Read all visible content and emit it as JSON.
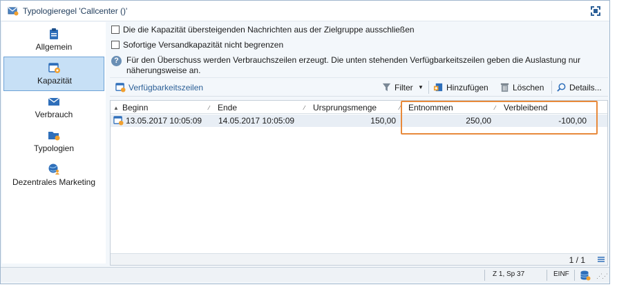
{
  "window": {
    "title": "Typologieregel 'Callcenter ()'"
  },
  "sidebar": {
    "items": [
      {
        "label": "Allgemein",
        "icon": "clipboard-icon"
      },
      {
        "label": "Kapazität",
        "icon": "calendar-gear-icon"
      },
      {
        "label": "Verbrauch",
        "icon": "envelope-down-icon"
      },
      {
        "label": "Typologien",
        "icon": "folder-rules-icon"
      },
      {
        "label": "Dezentrales Marketing",
        "icon": "globe-user-icon"
      }
    ],
    "active": "Kapazität"
  },
  "options": {
    "exclude_label": "Die die Kapazität übersteigenden Nachrichten aus der Zielgruppe ausschließen",
    "unlimited_label": "Sofortige Versandkapazität nicht begrenzen",
    "info_text": "Für den Überschuss werden Verbrauchszeilen erzeugt. Die unten stehenden Verfügbarkeitszeilen geben die Auslastung nur näherungsweise an."
  },
  "toolbar": {
    "section_title": "Verfügbarkeitszeilen",
    "filter_label": "Filter",
    "add_label": "Hinzufügen",
    "delete_label": "Löschen",
    "details_label": "Details..."
  },
  "grid": {
    "columns": [
      "Beginn",
      "Ende",
      "Ursprungsmenge",
      "Entnommen",
      "Verbleibend"
    ],
    "rows": [
      {
        "beginn": "13.05.2017 10:05:09",
        "ende": "14.05.2017 10:05:09",
        "ursprungsmenge": "150,00",
        "entnommen": "250,00",
        "verbleibend": "-100,00"
      }
    ],
    "pager": "1 / 1"
  },
  "status": {
    "position": "Z 1, Sp 37",
    "mode": "EINF"
  },
  "colors": {
    "accent": "#2a5e96",
    "active_nav": "#c7e0f6",
    "highlight": "#e8893a"
  }
}
